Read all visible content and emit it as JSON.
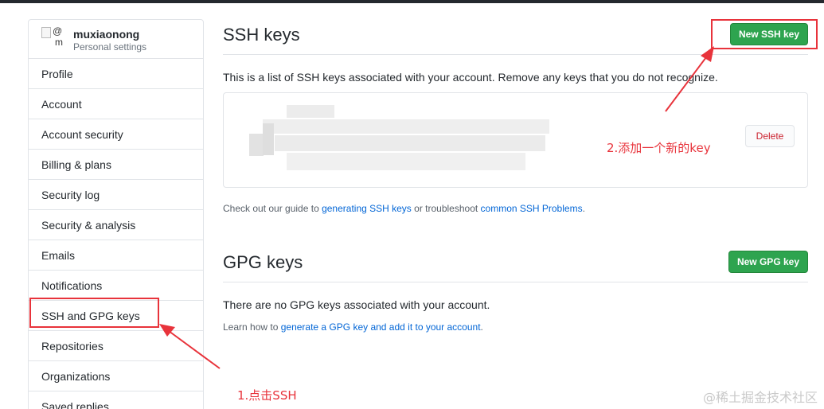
{
  "sidebar": {
    "username": "muxiaonong",
    "subtitle": "Personal settings",
    "avatar_alt": "@m",
    "items": [
      {
        "label": "Profile"
      },
      {
        "label": "Account"
      },
      {
        "label": "Account security"
      },
      {
        "label": "Billing & plans"
      },
      {
        "label": "Security log"
      },
      {
        "label": "Security & analysis"
      },
      {
        "label": "Emails"
      },
      {
        "label": "Notifications"
      },
      {
        "label": "SSH and GPG keys",
        "selected": true
      },
      {
        "label": "Repositories"
      },
      {
        "label": "Organizations"
      },
      {
        "label": "Saved replies"
      }
    ]
  },
  "ssh": {
    "title": "SSH keys",
    "new_button": "New SSH key",
    "description": "This is a list of SSH keys associated with your account. Remove any keys that you do not recognize.",
    "delete_button": "Delete",
    "guide_prefix": "Check out our guide to ",
    "guide_link1": "generating SSH keys",
    "guide_mid": " or troubleshoot ",
    "guide_link2": "common SSH Problems",
    "guide_suffix": "."
  },
  "gpg": {
    "title": "GPG keys",
    "new_button": "New GPG key",
    "empty_text": "There are no GPG keys associated with your account.",
    "learn_prefix": "Learn how to ",
    "learn_link": "generate a GPG key and add it to your account",
    "learn_suffix": "."
  },
  "annotations": {
    "step1": "1.点击SSH",
    "step2": "2.添加一个新的key"
  },
  "watermark": "@稀土掘金技术社区",
  "colors": {
    "accent_green": "#2ea44f",
    "link_blue": "#0366d6",
    "annotation_red": "#e8333b",
    "danger_red": "#cb2431"
  }
}
